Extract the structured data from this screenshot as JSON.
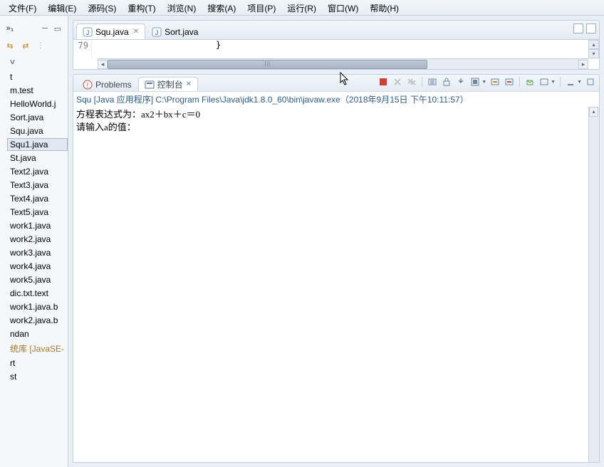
{
  "menubar": [
    "文件(F)",
    "编辑(E)",
    "源码(S)",
    "重构(T)",
    "浏览(N)",
    "搜索(A)",
    "项目(P)",
    "运行(R)",
    "窗口(W)",
    "帮助(H)"
  ],
  "sidebar": {
    "top_badge": "»₁",
    "items": [
      "t",
      "m.test",
      "HelloWorld.j",
      "Sort.java",
      "Squ.java",
      "Squ1.java",
      "St.java",
      "Text2.java",
      "Text3.java",
      "Text4.java",
      "Text5.java",
      "work1.java",
      "work2.java",
      "work3.java",
      "work4.java",
      "work5.java",
      "dic.txt.text",
      "work1.java.b",
      "work2.java.b",
      "ndan",
      "统库 [JavaSE-",
      "rt",
      "st"
    ],
    "selected_index": 5
  },
  "editor": {
    "tabs": [
      {
        "label": "Squ.java",
        "active": true,
        "closable": true
      },
      {
        "label": "Sort.java",
        "active": false,
        "closable": false
      }
    ],
    "visible_line_number": "79",
    "visible_code": "}"
  },
  "console": {
    "tabs": [
      {
        "label": "Problems",
        "active": false
      },
      {
        "label": "控制台",
        "active": true,
        "closable": true
      }
    ],
    "status": "Squ [Java 应用程序] C:\\Program Files\\Java\\jdk1.8.0_60\\bin\\javaw.exe（2018年9月15日 下午10:11:57）",
    "output": [
      "方程表达式为：ax2＋bx＋c＝0",
      "请输入a的值："
    ]
  },
  "icons": {
    "java_file": "J",
    "problems": "!",
    "console": "▣"
  }
}
